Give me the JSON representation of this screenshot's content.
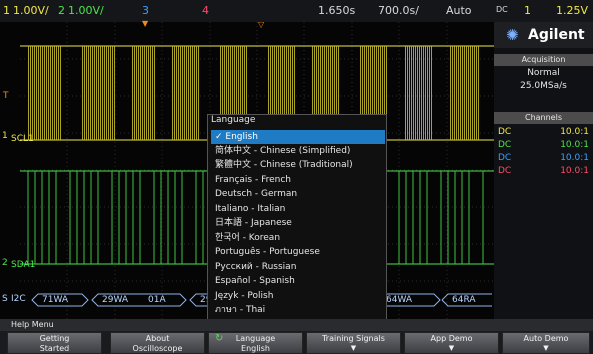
{
  "topbar": {
    "ch1": "1",
    "ch1_scale": "1.00V/",
    "ch2": "2",
    "ch2_scale": "1.00V/",
    "ch3": "3",
    "ch4": "4",
    "time_delay": "1.650",
    "delay_unit": "s",
    "time_scale": "700.0",
    "time_scale_unit": "s/",
    "trigger_mode": "Auto",
    "trigger_coupling": "DC",
    "trigger_source": "1",
    "trigger_level": "1.25V"
  },
  "panel": {
    "brand": "Agilent",
    "acquisition_header": "Acquisition",
    "acquisition_mode": "Normal",
    "sample_rate": "25.0MSa/s",
    "channels_header": "Channels",
    "channels": [
      {
        "coupling": "DC",
        "probe": "10.0:1",
        "color": "#f0e84a"
      },
      {
        "coupling": "DC",
        "probe": "10.0:1",
        "color": "#4be54b"
      },
      {
        "coupling": "DC",
        "probe": "10.0:1",
        "color": "#3aa0ff"
      },
      {
        "coupling": "DC",
        "probe": "10.0:1",
        "color": "#ff4b6a"
      }
    ]
  },
  "screen": {
    "scl_label": "SCL1",
    "sda_label": "SDA1",
    "ch1_marker": "1",
    "ch2_marker": "2",
    "trigger_marker": "T",
    "decode_label": "I2C",
    "decode_marker": "S",
    "decode_packets": [
      "71WA",
      "29WA",
      "01A",
      "29WA",
      "64WA",
      "64RA"
    ]
  },
  "language_menu": {
    "title": "Language",
    "items": [
      "✓ English",
      "简体中文 - Chinese (Simplified)",
      "繁體中文 - Chinese (Traditional)",
      "Français - French",
      "Deutsch - German",
      "Italiano - Italian",
      "日本語 - Japanese",
      "한국어 - Korean",
      "Português - Portuguese",
      "Русский - Russian",
      "Español - Spanish",
      "Język - Polish",
      "ภาษา - Thai"
    ],
    "selected_index": 0
  },
  "help": {
    "label": "Help Menu"
  },
  "softkeys": [
    {
      "line1": "Getting",
      "line2": "Started"
    },
    {
      "line1": "About",
      "line2": "Oscilloscope"
    },
    {
      "line1": "Language",
      "line2": "English"
    },
    {
      "line1": "Training Signals",
      "line2": ""
    },
    {
      "line1": "App Demo",
      "line2": ""
    },
    {
      "line1": "Auto Demo",
      "line2": ""
    }
  ],
  "colors": {
    "ch1": "#f0e84a",
    "ch2": "#4be54b",
    "ch3": "#3aa0ff",
    "ch4": "#ff4b6a",
    "selection": "#1e7bc4",
    "accent": "#f08a1a"
  }
}
